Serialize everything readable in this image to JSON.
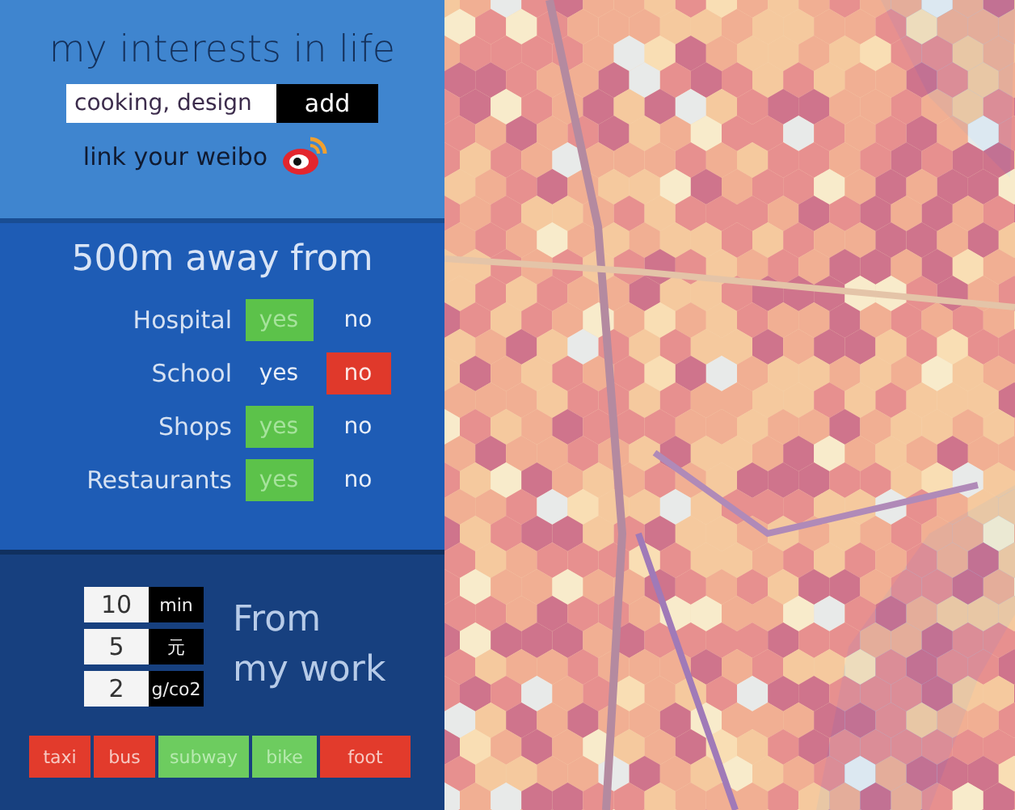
{
  "interests": {
    "title": "my interests in life",
    "field_value": "cooking, design",
    "add_button": "add",
    "weibo_label": "link your weibo"
  },
  "distance": {
    "title": "500m away from",
    "rows": [
      {
        "label": "Hospital",
        "options": [
          {
            "label": "yes",
            "selected": true
          },
          {
            "label": "no",
            "selected": false
          }
        ]
      },
      {
        "label": "School",
        "options": [
          {
            "label": "yes",
            "selected": false
          },
          {
            "label": "no",
            "selected": true
          }
        ]
      },
      {
        "label": "Shops",
        "options": [
          {
            "label": "yes",
            "selected": true
          },
          {
            "label": "no",
            "selected": false
          }
        ]
      },
      {
        "label": "Restaurants",
        "options": [
          {
            "label": "yes",
            "selected": true
          },
          {
            "label": "no",
            "selected": false
          }
        ]
      }
    ]
  },
  "commute": {
    "fields": [
      {
        "value": "10",
        "unit": "min"
      },
      {
        "value": "5",
        "unit": "元"
      },
      {
        "value": "2",
        "unit": "g/co2"
      }
    ],
    "title_lines": [
      "From",
      "my work"
    ],
    "modes": [
      {
        "label": "taxi",
        "selected": false
      },
      {
        "label": "bus",
        "selected": false
      },
      {
        "label": "subway",
        "selected": true
      },
      {
        "label": "bike",
        "selected": true
      },
      {
        "label": "foot",
        "selected": false
      }
    ]
  }
}
